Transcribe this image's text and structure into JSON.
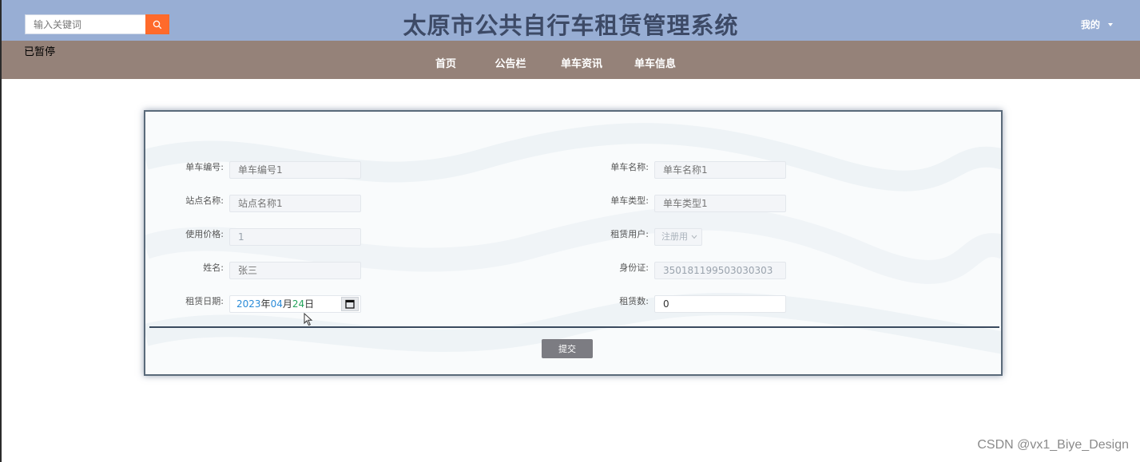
{
  "header": {
    "search_placeholder": "输入关键词",
    "title": "太原市公共自行车租赁管理系统",
    "user_menu_label": "我的",
    "colors": {
      "topbar": "#98aed4",
      "search_button": "#ff6a2b",
      "navbar": "#958279"
    }
  },
  "nav": {
    "paused_label": "已暂停",
    "items": [
      {
        "label": "首页"
      },
      {
        "label": "公告栏"
      },
      {
        "label": "单车资讯"
      },
      {
        "label": "单车信息"
      }
    ]
  },
  "form": {
    "bike_no": {
      "label": "单车编号:",
      "placeholder": "单车编号1"
    },
    "bike_name": {
      "label": "单车名称:",
      "placeholder": "单车名称1"
    },
    "station": {
      "label": "站点名称:",
      "placeholder": "站点名称1"
    },
    "bike_type": {
      "label": "单车类型:",
      "placeholder": "单车类型1"
    },
    "price": {
      "label": "使用价格:",
      "value": "1"
    },
    "renter": {
      "label": "租赁用户:",
      "value": "注册用"
    },
    "name": {
      "label": "姓名:",
      "placeholder": "张三"
    },
    "id_card": {
      "label": "身份证:",
      "value": "350181199503030303"
    },
    "date": {
      "label": "租赁日期:",
      "year": "2023",
      "year_unit": "年",
      "month": "04",
      "month_unit": "月",
      "day": "24",
      "day_unit": "日"
    },
    "count": {
      "label": "租赁数:",
      "value": "0"
    },
    "submit_label": "提交"
  },
  "watermark": "CSDN @vx1_Biye_Design"
}
